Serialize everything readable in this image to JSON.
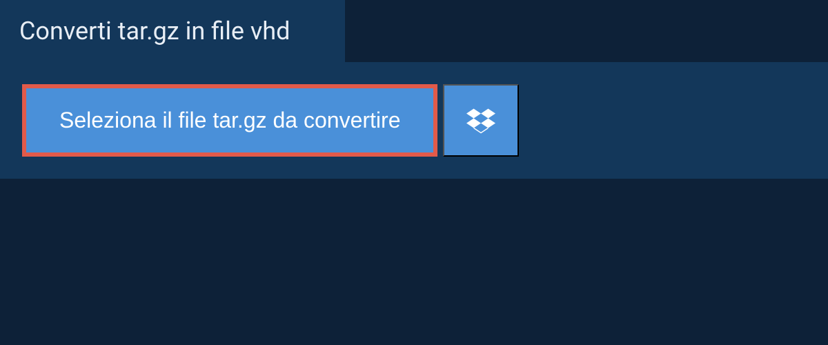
{
  "header": {
    "title": "Converti tar.gz in file vhd"
  },
  "actions": {
    "select_file_label": "Seleziona il file tar.gz da convertire",
    "dropbox_icon": "dropbox-icon"
  },
  "colors": {
    "background": "#0d2138",
    "panel": "#13375a",
    "button": "#4a90d9",
    "highlight_border": "#e25a4a",
    "text_light": "#ffffff"
  }
}
